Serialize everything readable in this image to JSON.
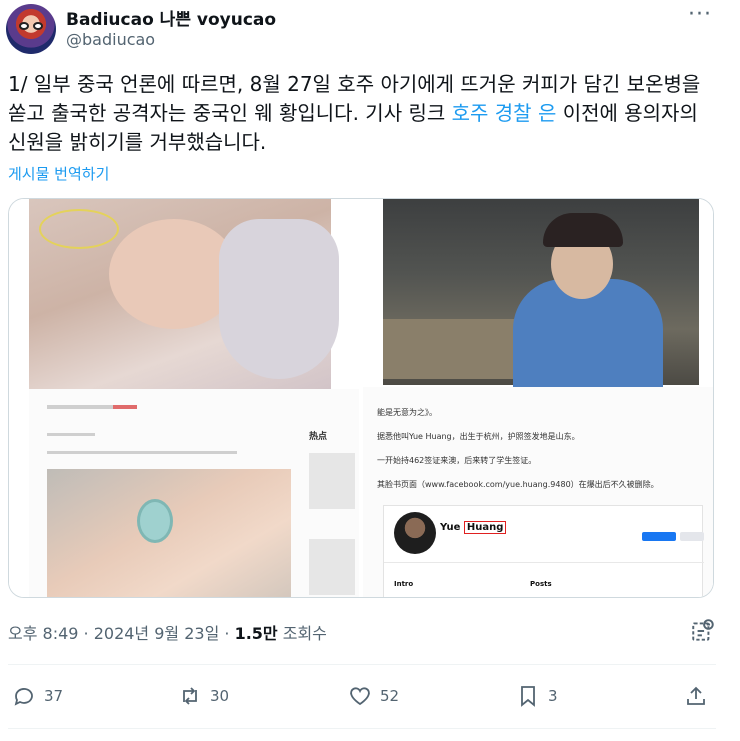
{
  "author": {
    "display_name": "Badiucao 나쁜 voyucao",
    "handle": "@badiucao"
  },
  "tweet": {
    "text_before_link": "1/ 일부 중국 언론에 따르면, 8월 27일 호주 아기에게 뜨거운 커피가 담긴 보온병을 쏟고 출국한 공격자는 중국인 웨 황입니다. 기사 링크 ",
    "link_text": "호주 경찰 은",
    "text_after_link": " 이전에 용의자의 신원을 밝히기를 거부했습니다.",
    "translate_label": "게시물 번역하기"
  },
  "media": {
    "left_article": {
      "hot_label": "热点"
    },
    "right_article": {
      "lines": [
        "能是无意为之》。",
        "据悉他叫Yue Huang，出生于杭州，护照签发地是山东。",
        "一开始持462签证来澳，后来转了学生签证。",
        "其脸书页面（www.facebook.com/yue.huang.9480）在爆出后不久被删除。"
      ],
      "fb_name_first": "Yue ",
      "fb_name_last": "Huang",
      "fb_intro": "Intro",
      "fb_posts": "Posts"
    }
  },
  "meta": {
    "time_date": "오후 8:49 · 2024년 9월 23일 · ",
    "views_count": "1.5만",
    "views_label": " 조회수"
  },
  "actions": {
    "replies": "37",
    "reposts": "30",
    "likes": "52",
    "bookmarks": "3"
  },
  "colors": {
    "link": "#1d9bf0",
    "secondary_text": "#536471",
    "primary_text": "#0f1419"
  },
  "icons": [
    "more-icon",
    "analytics-icon",
    "reply-icon",
    "repost-icon",
    "like-icon",
    "bookmark-icon",
    "share-icon"
  ]
}
